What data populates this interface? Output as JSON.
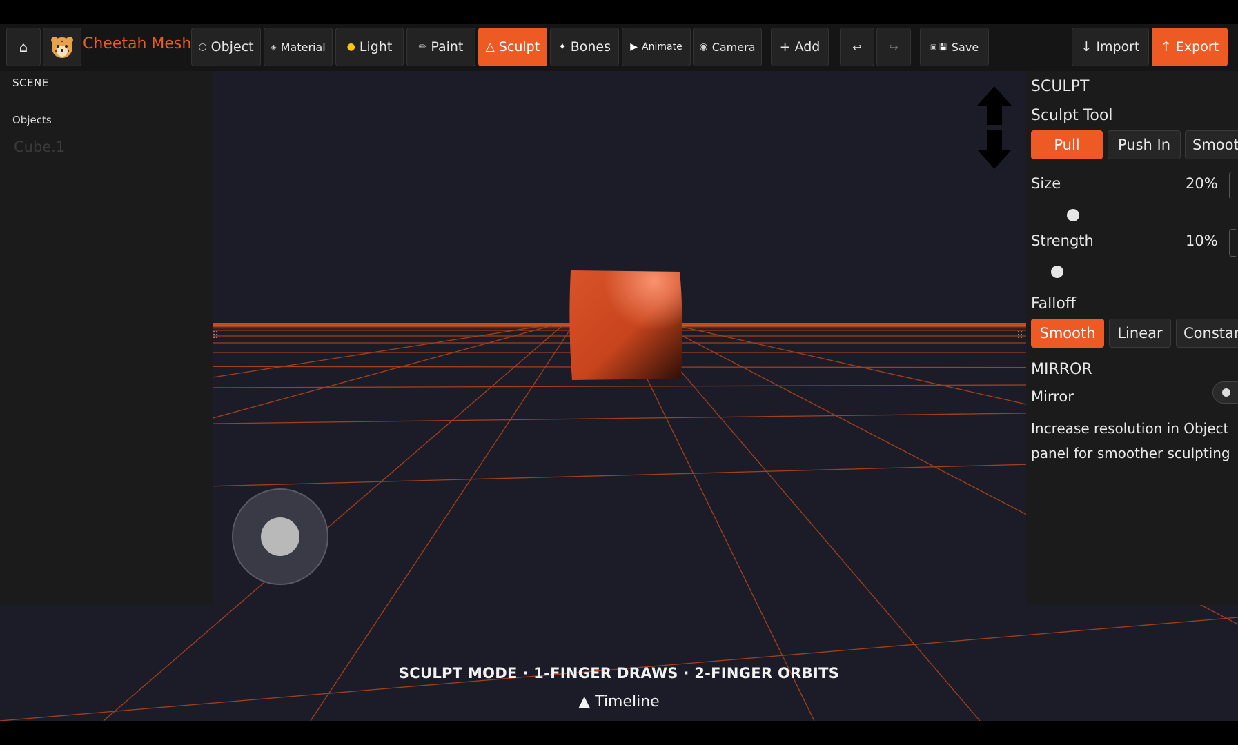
{
  "toolbar": {
    "home_icon": "home-icon",
    "brand": "Cheetah Mesh",
    "modes": [
      {
        "label": "Object",
        "icon": "○"
      },
      {
        "label": "Material",
        "icon": "◈"
      },
      {
        "label": "Light",
        "icon": "●"
      },
      {
        "label": "Paint",
        "icon": "✏"
      },
      {
        "label": "Sculpt",
        "icon": "△"
      },
      {
        "label": "Bones",
        "icon": "✦"
      },
      {
        "label": "Animate",
        "icon": "▶"
      },
      {
        "label": "Camera",
        "icon": "◉"
      }
    ],
    "active_mode": "Sculpt",
    "add_label": "+ Add",
    "undo_icon": "↩",
    "redo_icon": "↪",
    "save_label": "Save",
    "save_icon": "▣ 💾",
    "import_label": "↓ Import",
    "export_label": "↑ Export"
  },
  "scene": {
    "header": "SCENE",
    "objects_label": "Objects",
    "objects": [
      "Cube.1"
    ]
  },
  "sculpt_panel": {
    "header": "SCULPT",
    "tool_label": "Sculpt Tool",
    "tools": [
      "Pull",
      "Push In",
      "Smooth"
    ],
    "active_tool": "Pull",
    "size_label": "Size",
    "size_value": "20%",
    "strength_label": "Strength",
    "strength_value": "10%",
    "falloff_label": "Falloff",
    "falloffs": [
      "Smooth",
      "Linear",
      "Constant"
    ],
    "active_falloff": "Smooth",
    "mirror_header": "MIRROR",
    "mirror_label": "Mirror",
    "tip_line1": "Increase resolution in Object",
    "tip_line2": "panel for smoother sculpting"
  },
  "viewport": {
    "hint": "SCULPT MODE · 1-FINGER DRAWS · 2-FINGER ORBITS",
    "timeline_label": "▲ Timeline",
    "up_arrow_icon": "arrow-up-icon",
    "down_arrow_icon": "arrow-down-icon"
  },
  "colors": {
    "accent": "#ee5a24",
    "background": "#1c1c28",
    "panel": "#1b1b1b",
    "grid": "#a3401c"
  }
}
